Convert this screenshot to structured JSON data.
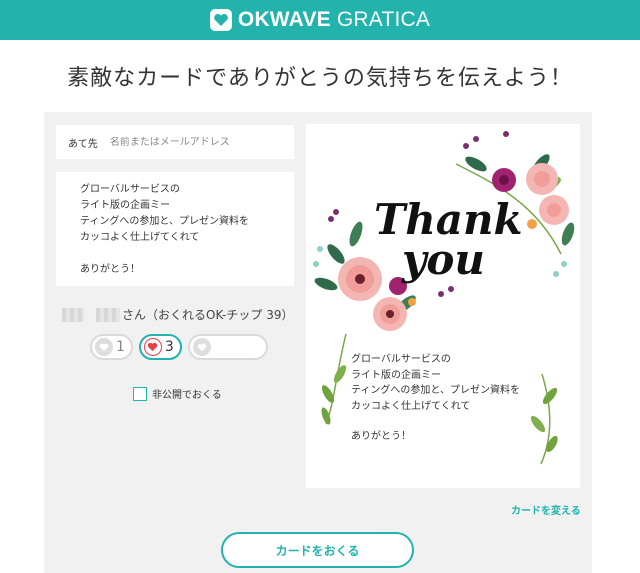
{
  "header": {
    "logo_bold": "OKWAVE",
    "logo_light": "GRATICA",
    "logo_icon": "heart-icon"
  },
  "page": {
    "title": "素敵なカードでありがとうの気持ちを伝えよう！"
  },
  "form": {
    "to_label": "あて先",
    "to_placeholder": "名前またはメールアドレス",
    "message_lines": [
      "グローバルサービスの",
      "ライト版の企画ミー",
      "ティングへの参加と、プレゼン資料を",
      "カッコよく仕上げてくれて"
    ],
    "message_closing": "ありがとう！",
    "sender_suffix": "さん（おくれるOK-チップ 39）",
    "tips": [
      {
        "value": "1",
        "selected": false
      },
      {
        "value": "3",
        "selected": true
      },
      {
        "value": "",
        "selected": false
      }
    ],
    "private_label": "非公開でおくる"
  },
  "card": {
    "art_text_1": "Thank",
    "art_text_2": "you",
    "message_lines": [
      "グローバルサービスの",
      "ライト版の企画ミー",
      "ティングへの参加と、プレゼン資料を",
      "カッコよく仕上げてくれて"
    ],
    "message_closing": "ありがとう！",
    "change_label": "カードを変える"
  },
  "actions": {
    "send_label": "カードをおくる"
  },
  "colors": {
    "accent": "#22b3ad",
    "heart": "#e64048",
    "panel": "#f1f1f1"
  }
}
